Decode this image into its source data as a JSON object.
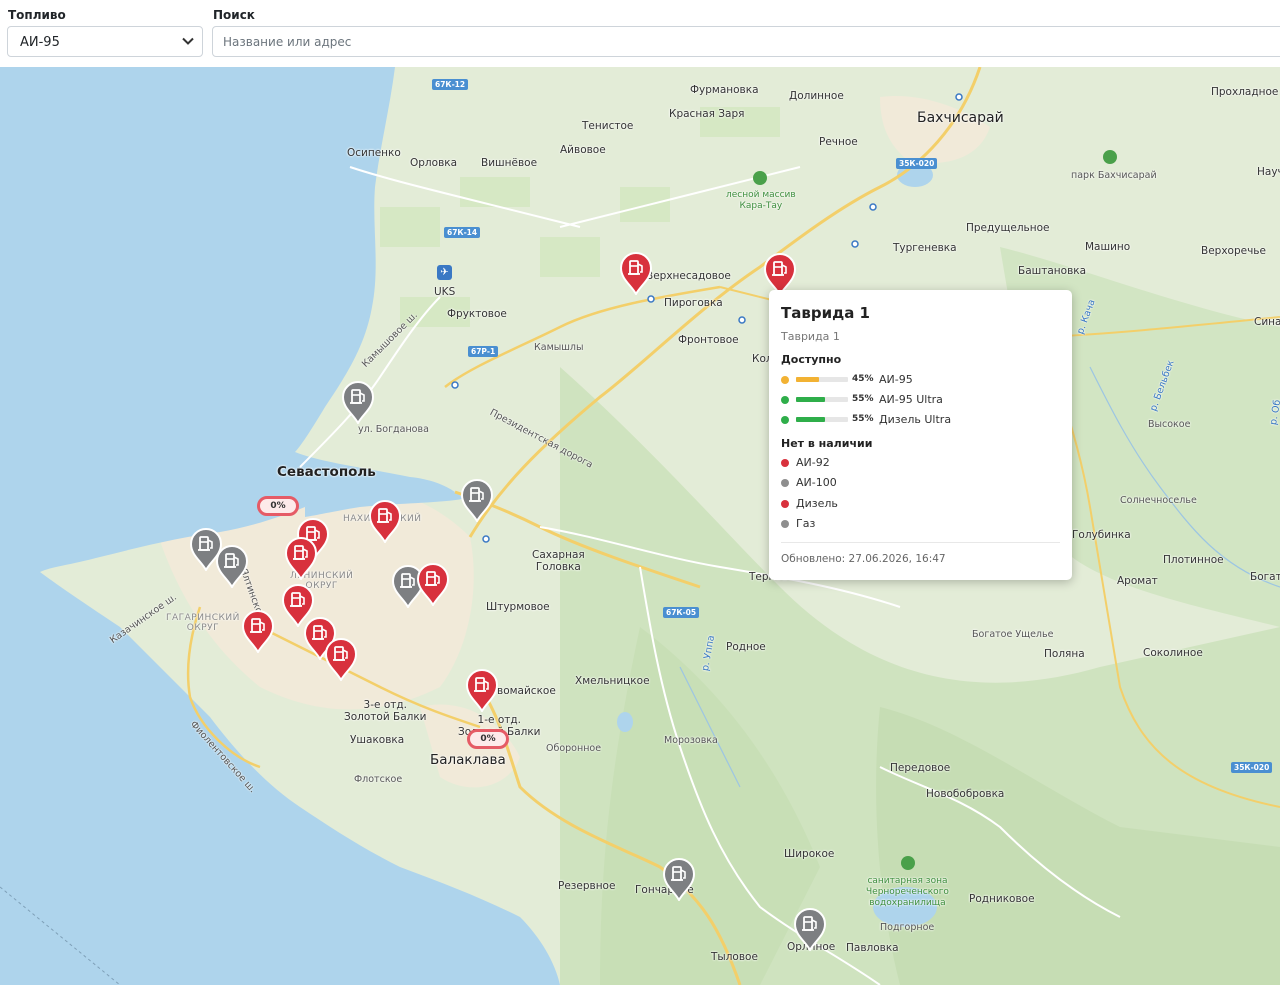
{
  "controls": {
    "fuel_label": "Топливо",
    "fuel_selected": "АИ-95",
    "search_label": "Поиск",
    "search_placeholder": "Название или адрес"
  },
  "map": {
    "places": {
      "furmanovka": "Фурмановка",
      "dolinnoe": "Долинное",
      "prohladnoe": "Прохладное",
      "bakhchisaray": "Бахчисарай",
      "tenistoe": "Тенистое",
      "krasnaya_zarya": "Красная Заря",
      "nauch": "Науч",
      "osipenko": "Осипенко",
      "orlovka": "Орловка",
      "vishnevoe": "Вишнёвое",
      "ayvovoe": "Айвовое",
      "rechnoe": "Речное",
      "park_bakhchisaray": "парк Бахчисарай",
      "forest_karatau": "лесной массив\nКара-Тау",
      "predushchelnoe": "Предущельное",
      "turgenevka": "Тургеневка",
      "mashino": "Машино",
      "verkhorechye": "Верхоречье",
      "bashtanovka": "Баштановка",
      "sina": "Сина",
      "verkhnesadovoe": "Верхнесадовое",
      "pirogovka": "Пироговка",
      "uks": "UKS",
      "fruktovoe": "Фруктовое",
      "kamyshly": "Камышлы",
      "frontovoe": "Фронтовое",
      "kol": "Кол",
      "kamyshovoe_sh": "Камышовое ш.",
      "prezidentskaya": "Президентская дорога",
      "bogdanova": "ул. Богданова",
      "vysokoe": "Высокое",
      "sevastopol": "Севастополь",
      "nakhimovsky": "НАХИМОВСКИЙ",
      "leninsky": "ЛЕНИНСКИЙ\nОКРУГ",
      "gagarinsky": "ГАГАРИНСКИЙ\nОКРУГ",
      "kazachinskoe_sh": "Казачинское ш.",
      "vostochnoe_sh": "Ялтинское ш.",
      "sakharnaya": "Сахарная\nГоловка",
      "shturmovoe": "Штурмовое",
      "ternovka": "Терновка",
      "solnechnoselye": "Солнечноселье",
      "golubinka": "Голубинка",
      "plotinnoe": "Плотинное",
      "aromat": "Аромат",
      "bogat": "Богат",
      "bogatoe_ushchelie": "Богатое Ущелье",
      "polyana": "Поляна",
      "sokolinoe": "Соколиное",
      "rodnoe": "Родное",
      "khmelnitskoe": "Хмельницкое",
      "mayskoe": "Первомайское",
      "zolotaya_balka3": "3-е отд.\nЗолотой Балки",
      "zolotaya_balka1": "1-е отд.\nЗолотой Балки",
      "ushakovka": "Ушаковка",
      "balaklava": "Балаклава",
      "oboronnoe": "Оборонное",
      "morozovka": "Морозовка",
      "flotskoe": "Флотское",
      "fiolentovskoe": "Фиолентовское ш.",
      "peredovoe": "Передовое",
      "novobobrovka": "Новобобровка",
      "shirokoe": "Широкое",
      "sanitary_zone": "санитарная зона\nЧернореченского\nводохранилища",
      "rezervnoe": "Резервное",
      "goncharnoe": "Гончарное",
      "rodnikovoe": "Родниковое",
      "podgornoe": "Подгорное",
      "orlinoe": "Орлиное",
      "pavlovka": "Павловка",
      "tylovoe": "Тыловое",
      "yupla": "р. Уппа",
      "kacha": "р. Кача",
      "belbek": "р. Бельбек",
      "bobo": "р. Об"
    },
    "road_badges": [
      "67К-12",
      "35К-020",
      "67К-14",
      "67Р-1",
      "67К-05",
      "35К-020"
    ]
  },
  "markers": [
    {
      "status": "available",
      "color": "#d8313d"
    },
    {
      "status": "unavailable",
      "color": "#7d7f82"
    }
  ],
  "price_badges": [
    "0%",
    "0%"
  ],
  "popup": {
    "title": "Таврида 1",
    "subtitle": "Таврида 1",
    "available_header": "Доступно",
    "available": [
      {
        "name": "АИ-95",
        "percent": "45%",
        "level": 0.45,
        "color": "#f2b233"
      },
      {
        "name": "АИ-95 Ultra",
        "percent": "55%",
        "level": 0.55,
        "color": "#2fae4a"
      },
      {
        "name": "Дизель Ultra",
        "percent": "55%",
        "level": 0.55,
        "color": "#2fae4a"
      }
    ],
    "unavailable_header": "Нет в наличии",
    "unavailable": [
      {
        "name": "АИ-92",
        "color": "#d8313d"
      },
      {
        "name": "АИ-100",
        "color": "#8e8e8e"
      },
      {
        "name": "Дизель",
        "color": "#d8313d"
      },
      {
        "name": "Газ",
        "color": "#8e8e8e"
      }
    ],
    "updated": "Обновлено: 27.06.2026, 16:47"
  }
}
